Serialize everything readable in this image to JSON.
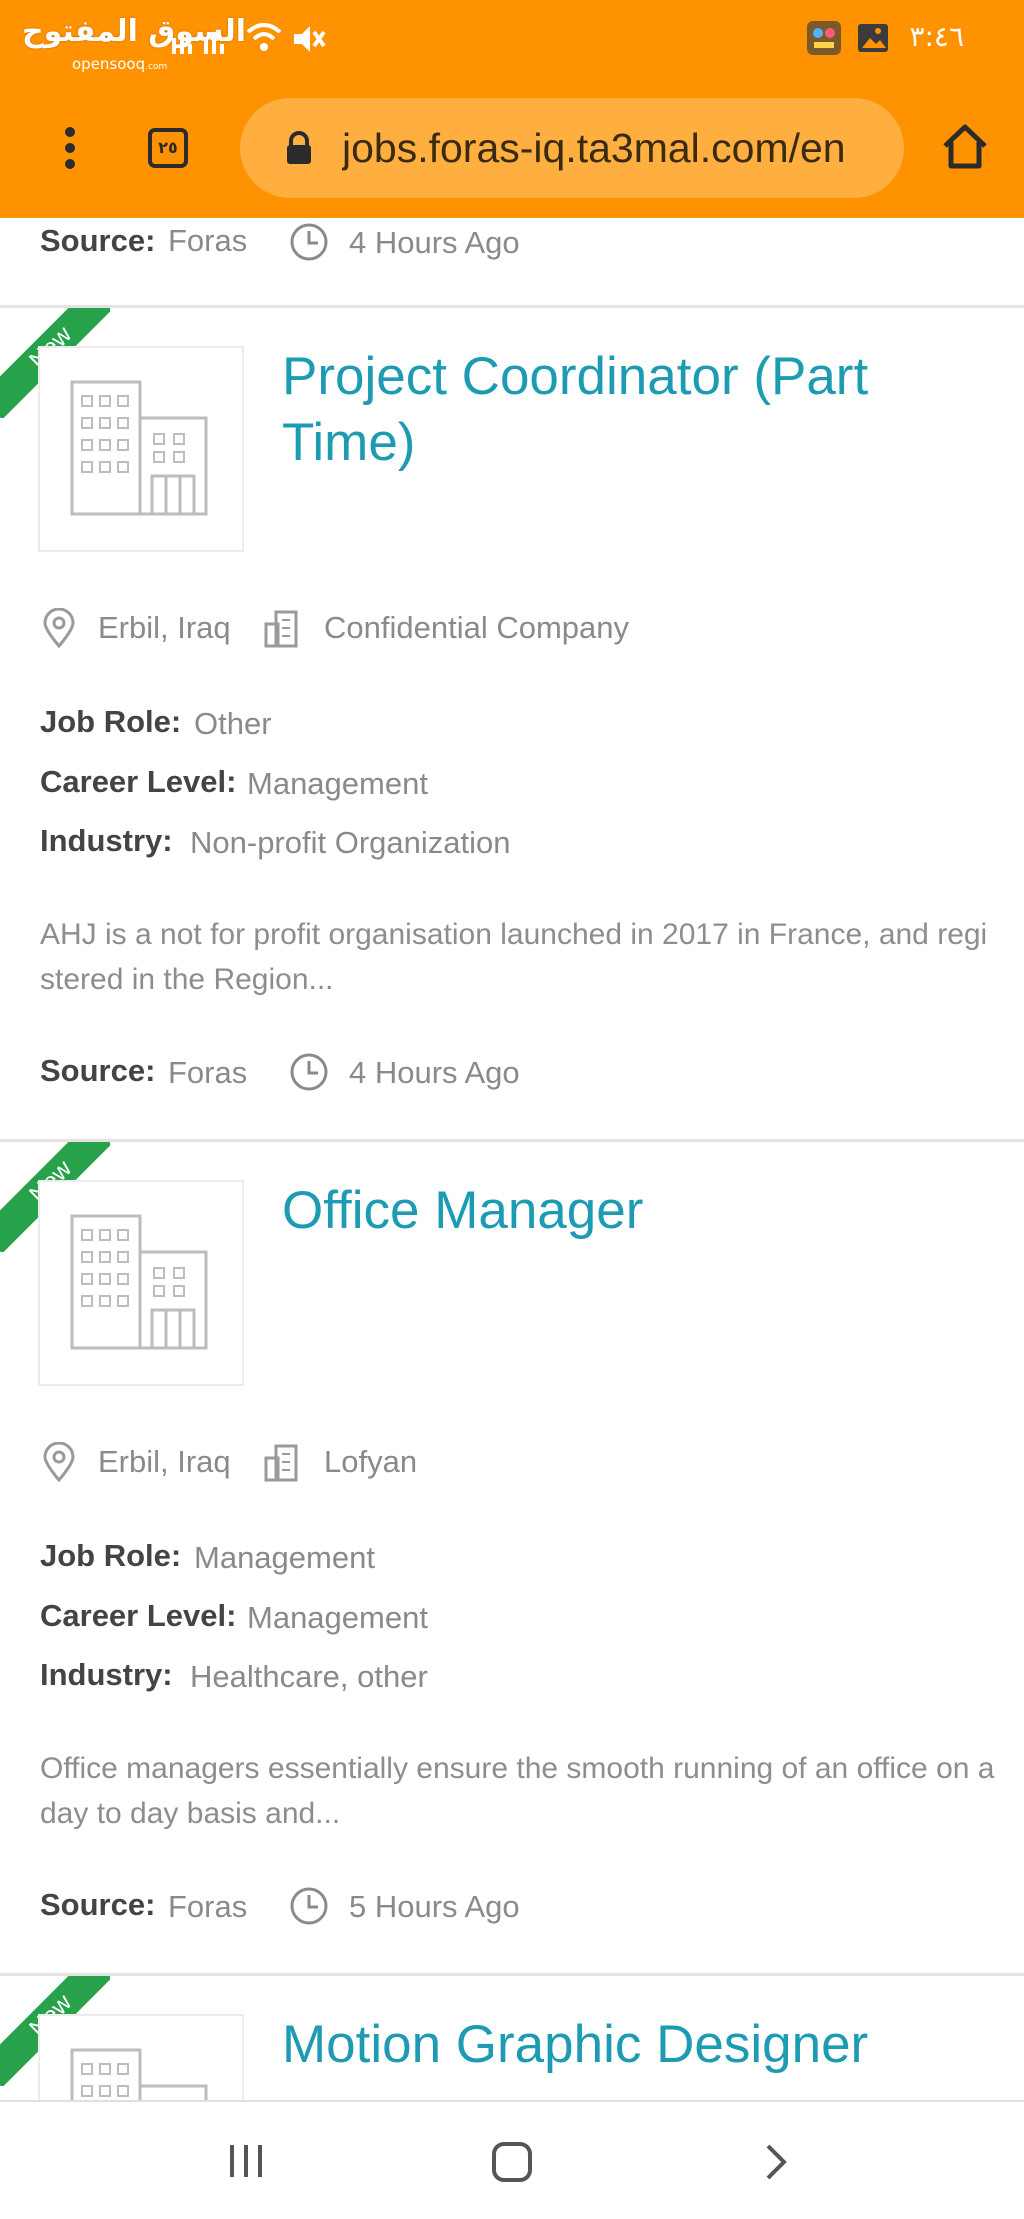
{
  "status_bar": {
    "watermark_arabic": "السوق المفتوح",
    "watermark_latin": "opensooq",
    "watermark_suffix": ".com",
    "time": "٣:٤٦"
  },
  "browser": {
    "url": "jobs.foras-iq.ta3mal.com/en",
    "tab_count": "٢٥"
  },
  "top_partial": {
    "source_label": "Source:",
    "source_value": "Foras",
    "time_ago": "4 Hours Ago"
  },
  "jobs": [
    {
      "badge": "New",
      "title": "Project Coordinator (Part Time)",
      "location": "Erbil, Iraq",
      "company": "Confidential Company",
      "job_role_label": "Job Role:",
      "job_role": "Other",
      "career_level_label": "Career Level:",
      "career_level": "Management",
      "industry_label": "Industry:",
      "industry": "Non-profit Organization",
      "description": "AHJ is a not for profit organisation launched in 2017 in France, and registered in the Region...",
      "source_label": "Source:",
      "source": "Foras",
      "time_ago": "4 Hours Ago"
    },
    {
      "badge": "New",
      "title": "Office Manager",
      "location": "Erbil, Iraq",
      "company": "Lofyan",
      "job_role_label": "Job Role:",
      "job_role": "Management",
      "career_level_label": "Career Level:",
      "career_level": "Management",
      "industry_label": "Industry:",
      "industry": "Healthcare, other",
      "description": "Office managers essentially ensure the smooth running of an office on a day to day basis and...",
      "source_label": "Source:",
      "source": "Foras",
      "time_ago": "5 Hours Ago"
    },
    {
      "badge": "New",
      "title": "Motion Graphic Designer"
    }
  ],
  "colors": {
    "chrome": "#ff9200",
    "title": "#1d9bb3",
    "badge": "#27a14a"
  }
}
